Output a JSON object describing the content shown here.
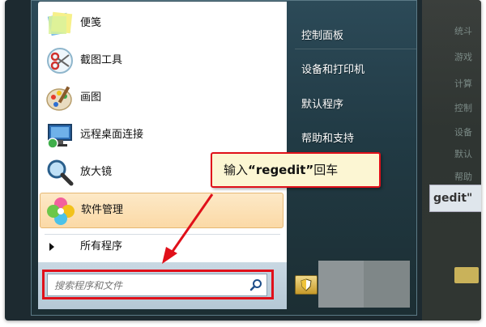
{
  "start_menu": {
    "programs": [
      {
        "label": "便笺",
        "icon": "sticky-notes-icon"
      },
      {
        "label": "截图工具",
        "icon": "snipping-tool-icon"
      },
      {
        "label": "画图",
        "icon": "paint-icon"
      },
      {
        "label": "远程桌面连接",
        "icon": "remote-desktop-icon"
      },
      {
        "label": "放大镜",
        "icon": "magnifier-icon"
      },
      {
        "label": "软件管理",
        "icon": "software-manager-icon"
      }
    ],
    "all_programs": "所有程序",
    "search": {
      "placeholder": "搜索程序和文件",
      "value": ""
    },
    "right_links": [
      "控制面板",
      "设备和打印机",
      "默认程序",
      "帮助和支持"
    ]
  },
  "background_fragments": [
    "统斗",
    "游戏",
    "计算",
    "控制",
    "设备",
    "默认",
    "帮助",
    "gedit\""
  ],
  "callout": {
    "prefix": "输入",
    "keyword": "“regedit”",
    "suffix": "回车"
  },
  "colors": {
    "highlight": "#fbd9a6",
    "annotation_red": "#e0101a",
    "callout_bg": "#fcf6d3",
    "menu_dark": "#213a44"
  }
}
